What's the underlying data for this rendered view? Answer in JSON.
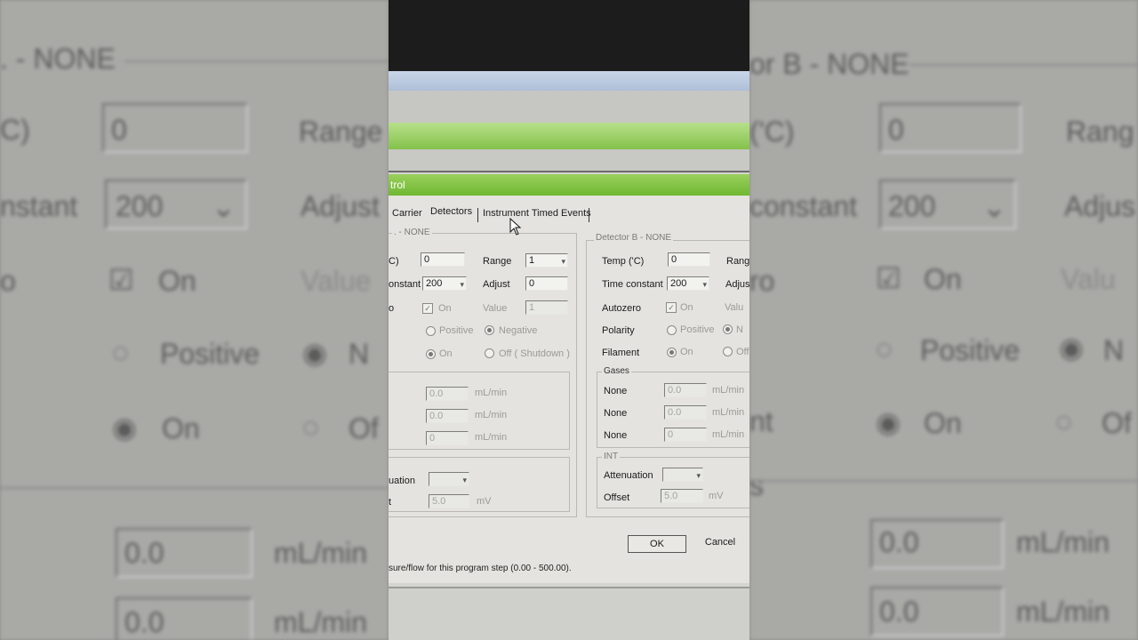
{
  "left_bg": {
    "header": ". - NONE",
    "rows": [
      "C)",
      "nstant",
      "o"
    ],
    "temp_value": "0",
    "range_label": "Range",
    "tc_value": "200",
    "adjust_label": "Adjust",
    "on_label": "On",
    "value_label": "Value",
    "positive_label": "Positive",
    "neg_label": "N",
    "on2_label": "On",
    "off_label": "Of",
    "flow1": "0.0",
    "flow2": "0.0",
    "unit": "mL/min"
  },
  "right_bg": {
    "header": "or B - NONE",
    "temp_label": "('C)",
    "temp_value": "0",
    "range_label": "Rang",
    "tc_label": "constant",
    "tc_value": "200",
    "adjust_label": "Adjus",
    "auto_label": "ro",
    "on_label": "On",
    "value_label": "Valu",
    "positive_label": "Positive",
    "neg_label": "N",
    "on2_label": "On",
    "off_label": "Of",
    "flow1": "0.0",
    "flow2": "0.0",
    "unit": "mL/min",
    "nt_label": "nt",
    "s_label": "s"
  },
  "dialog": {
    "title": "trol",
    "tabs": [
      "Carrier",
      "Detectors",
      "Instrument Timed Events"
    ],
    "detA": {
      "header": ". - NONE",
      "temp_label": "C)",
      "temp_value": "0",
      "range_label": "Range",
      "range_value": "1",
      "tc_label": "onstant",
      "tc_value": "200",
      "adjust_label": "Adjust",
      "adjust_value": "0",
      "auto_label": "o",
      "auto_on": "On",
      "value_label": "Value",
      "value_value": "1",
      "positive": "Positive",
      "negative": "Negative",
      "fil_on": "On",
      "fil_off": "Off ( Shutdown )",
      "gas1": "0.0",
      "gas2": "0.0",
      "gas3": "0",
      "unit": "mL/min",
      "atten_label": "uation",
      "offset_label": "t",
      "offset_value": "5.0",
      "mv": "mV"
    },
    "detB": {
      "header": "Detector B - NONE",
      "temp_label": "Temp ('C)",
      "temp_value": "0",
      "range_label": "Rang",
      "tc_label": "Time constant",
      "tc_value": "200",
      "adjust_label": "Adjus",
      "auto_label": "Autozero",
      "auto_on": "On",
      "value_label": "Valu",
      "polarity_label": "Polarity",
      "positive": "Positive",
      "negative": "N",
      "filament_label": "Filament",
      "fil_on": "On",
      "fil_off": "Off",
      "gases_header": "Gases",
      "gas_name": "None",
      "gas1": "0.0",
      "gas2": "0.0",
      "gas3": "0",
      "unit": "mL/min",
      "int_header": "INT",
      "atten_label": "Attenuation",
      "offset_label": "Offset",
      "offset_value": "5.0",
      "mv": "mV"
    },
    "ok_label": "OK",
    "cancel_label": "Cancel",
    "status": "sure/flow for this program step (0.00 - 500.00)."
  }
}
